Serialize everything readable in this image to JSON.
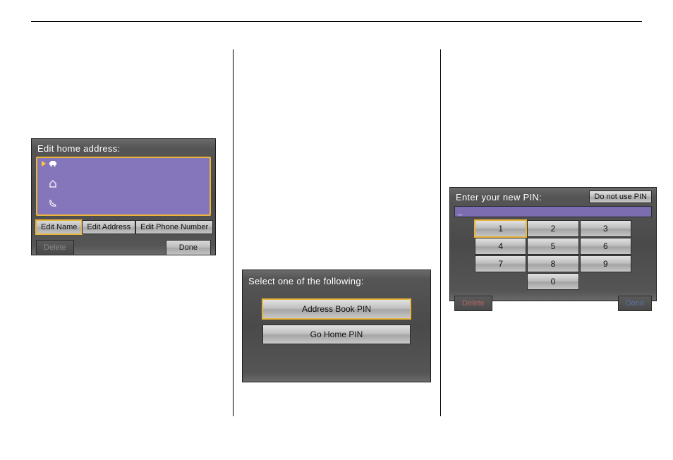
{
  "panel1": {
    "title": "Edit home address:",
    "buttons": {
      "edit_name": "Edit Name",
      "edit_address": "Edit Address",
      "edit_phone": "Edit Phone Number"
    },
    "delete": "Delete",
    "done": "Done"
  },
  "panel2": {
    "title": "Select one of the following:",
    "address_book_pin": "Address Book PIN",
    "go_home_pin": "Go Home PIN"
  },
  "panel3": {
    "title": "Enter your new PIN:",
    "do_not_use_pin": "Do not use PIN",
    "display_value": "_",
    "keys": [
      "1",
      "2",
      "3",
      "4",
      "5",
      "6",
      "7",
      "8",
      "9"
    ],
    "zero": "0",
    "delete": "Delete",
    "done": "Done"
  }
}
